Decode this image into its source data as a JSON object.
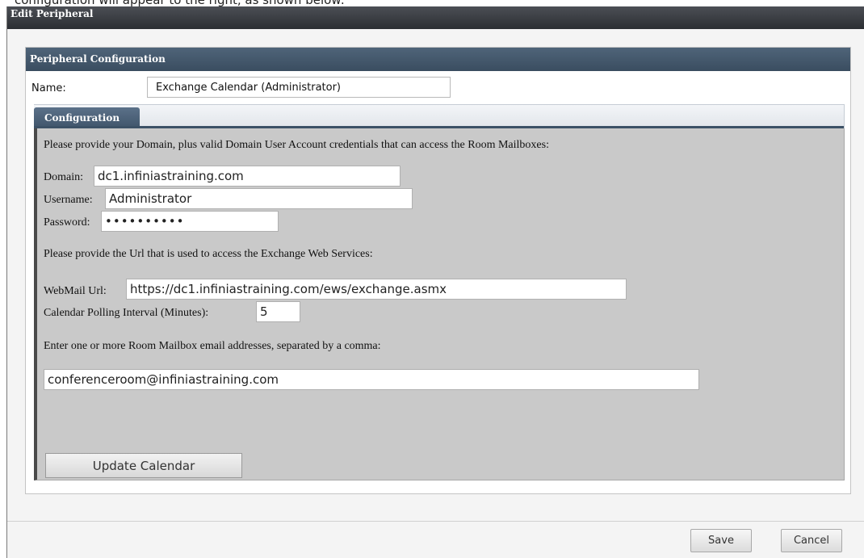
{
  "caption": "configuration will appear to the right, as shown below:",
  "dialog": {
    "title": "Edit Peripheral",
    "save_label": "Save",
    "cancel_label": "Cancel"
  },
  "panel": {
    "title": "Peripheral Configuration",
    "name_label": "Name:",
    "name_value": "Exchange Calendar (Administrator)"
  },
  "tabs": [
    {
      "label": "Configuration",
      "active": true
    }
  ],
  "config": {
    "intro_text": "Please provide your Domain, plus valid Domain User Account credentials that can access the Room Mailboxes:",
    "domain_label": "Domain:",
    "domain_value": "dc1.infiniastraining.com",
    "username_label": "Username:",
    "username_value": "Administrator",
    "password_label": "Password:",
    "password_value": "••••••••••",
    "url_intro_text": "Please provide the Url that is used to access the Exchange Web Services:",
    "webmail_label": "WebMail Url:",
    "webmail_value": "https://dc1.infiniastraining.com/ews/exchange.asmx",
    "polling_label": "Calendar Polling Interval (Minutes):",
    "polling_value": "5",
    "mailbox_intro_text": "Enter one or more Room Mailbox email addresses, separated by a comma:",
    "mailbox_value": "conferenceroom@infiniastraining.com",
    "update_button_label": "Update Calendar"
  },
  "colors": {
    "titlebar": "#2b2e33",
    "panel_header": "#3a4d60",
    "tab_active": "#3e5369",
    "content_bg": "#c9c9c9"
  }
}
